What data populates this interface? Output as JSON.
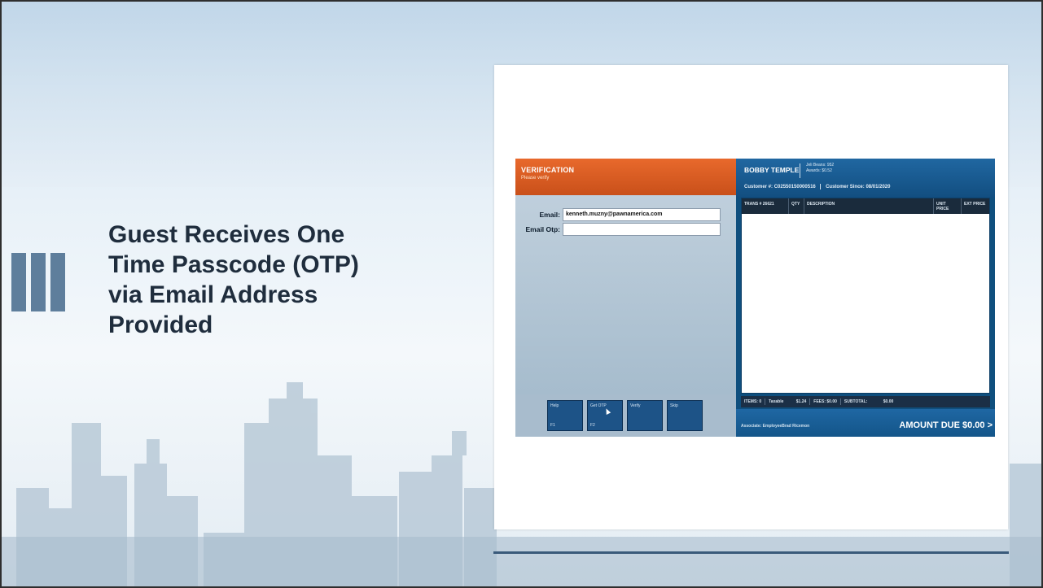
{
  "slide": {
    "title_lines": [
      "Guest Receives One",
      "Time Passcode (OTP)",
      "via Email Address",
      "Provided"
    ]
  },
  "pos": {
    "verification": {
      "title": "VERIFICATION",
      "subtitle": "Please verify",
      "email_label": "Email:",
      "email_value": "kenneth.muzny@pawnamerica.com",
      "otp_label": "Email Otp:",
      "otp_value": ""
    },
    "fkeys": [
      {
        "label": "Help",
        "code": "F1"
      },
      {
        "label": "Get OTP",
        "code": "F2"
      },
      {
        "label": "Verify",
        "code": ""
      },
      {
        "label": "Skip",
        "code": ""
      }
    ],
    "customer": {
      "name": "BOBBY TEMPLE",
      "points_line1": "Jeli Beans: 952",
      "points_line2": "Awards: $0.52",
      "number_label": "Customer #:",
      "number_value": "C02550150000516",
      "since_label": "Customer Since:",
      "since_value": "08/01/2020"
    },
    "table": {
      "headers": [
        "TRANS # 26621",
        "QTY",
        "DESCRIPTION",
        "UNIT PRICE",
        "EXT PRICE"
      ]
    },
    "totals": {
      "items": "ITEMS: 0",
      "taxable": "Taxable",
      "taxable_value": "$1.24",
      "fees": "FEES: $0.00",
      "subtotal": "SUBTOTAL:",
      "subtotal_value": "$0.00"
    },
    "associate": "Associate: EmployeeBrad Ricemon",
    "amount_due": "AMOUNT DUE $0.00 >"
  },
  "colors": {
    "verification_header": "#e8692c",
    "pos_blue": "#135589",
    "title_text": "#1f2d3d",
    "accent_bars": "#5e7e9c"
  }
}
